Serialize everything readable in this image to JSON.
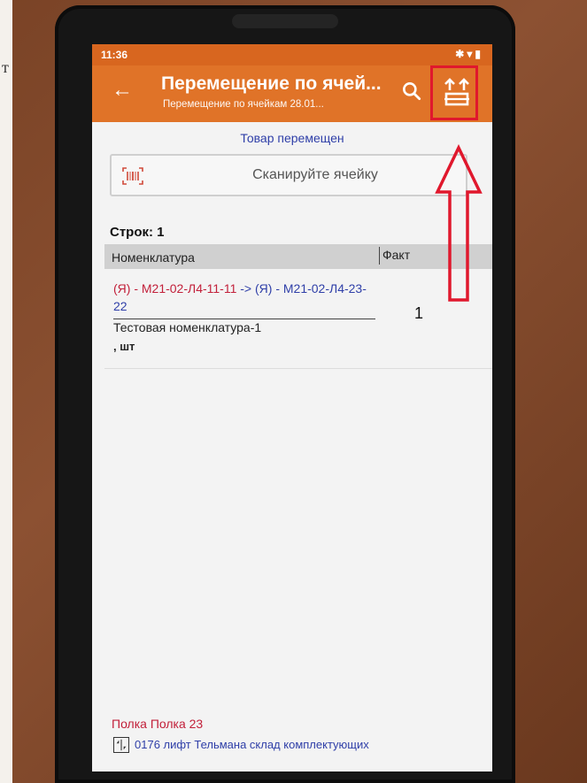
{
  "status_bar": {
    "time": "11:36",
    "icons": [
      "bluetooth-icon",
      "wifi-icon",
      "battery-icon"
    ]
  },
  "app_bar": {
    "title": "Перемещение по ячей...",
    "subtitle": "Перемещение по ячейкам 28.01...",
    "back_icon": "arrow-left-icon",
    "search_icon": "search-icon",
    "move_icon": "move-cell-icon",
    "color": "#e07328"
  },
  "message": "Товар перемещен",
  "scan": {
    "placeholder": "Сканируйте ячейку"
  },
  "rows": {
    "count_label": "Строк: 1"
  },
  "table": {
    "columns": [
      "Номенклатура",
      "Факт"
    ],
    "items": [
      {
        "from": "(Я) - М21-02-Л4-11-11",
        "arrow": "->",
        "to": "(Я) - М21-02-Л4-23-22",
        "name": "Тестовая номенклатура-1",
        "unit": ", шт",
        "fact": "1"
      }
    ]
  },
  "footer": {
    "shelf": "Полка Полка 23",
    "location": "0176 лифт Тельмана склад комплектующих"
  },
  "page_strip_char": "т",
  "colors": {
    "accent": "#e07328",
    "status": "#d8661f",
    "highlight": "#e0182d",
    "link_blue": "#2f3fa8",
    "link_red": "#c2203a"
  }
}
